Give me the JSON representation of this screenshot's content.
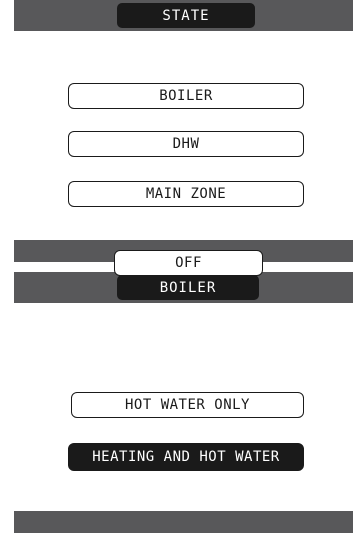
{
  "screens": [
    {
      "title": "STATE",
      "options": [
        {
          "label": "BOILER",
          "selected": false
        },
        {
          "label": "DHW",
          "selected": false
        },
        {
          "label": "MAIN ZONE",
          "selected": false
        }
      ]
    },
    {
      "title": "BOILER",
      "options": [
        {
          "label": "OFF",
          "selected": false
        },
        {
          "label": "HOT WATER ONLY",
          "selected": false
        },
        {
          "label": "HEATING AND HOT WATER",
          "selected": true
        }
      ]
    }
  ],
  "colors": {
    "bar": "#58585a",
    "tab": "#1a1a1a",
    "selected_bg": "#1a1a1a",
    "background": "#ffffff"
  }
}
